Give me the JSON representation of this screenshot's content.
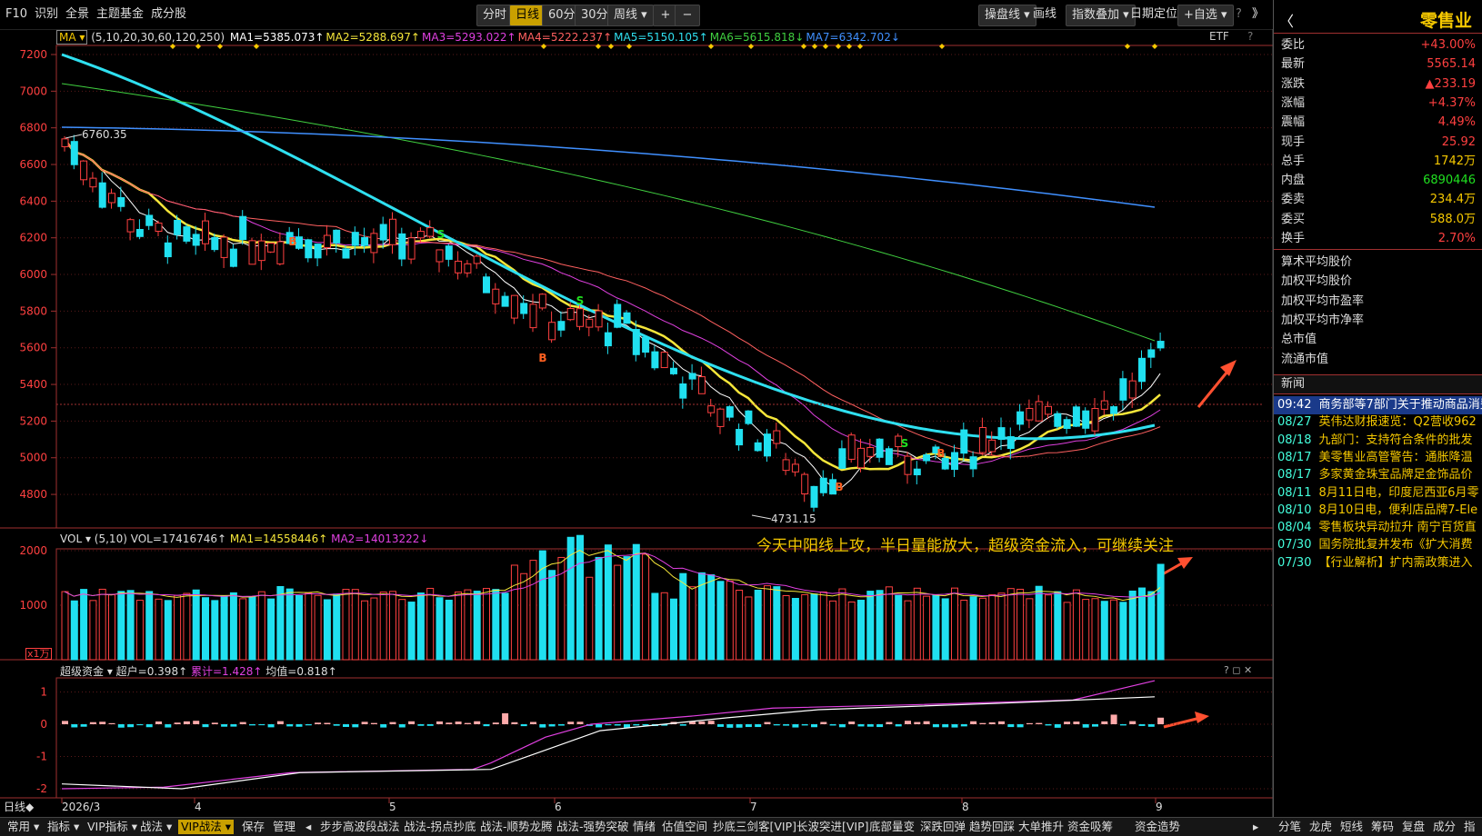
{
  "topbar": {
    "items": [
      "F10",
      "识别",
      "全景",
      "主题基金",
      "成分股"
    ],
    "periods": [
      "分时",
      "日线",
      "60分",
      "30分",
      "周线 ▾"
    ],
    "active_period": "日线",
    "zoom_in": "+",
    "zoom_out": "−",
    "right_items": [
      "操盘线 ▾",
      "画线",
      "指数叠加 ▾",
      "日期定位",
      "+自选 ▾"
    ],
    "help": "?",
    "collapse": "》"
  },
  "ma_legend": {
    "selector": "MA ▾",
    "params": "(5,10,20,30,60,120,250)",
    "lines": [
      {
        "text": "MA1=5385.073↑",
        "color": "#ffffff"
      },
      {
        "text": "MA2=5288.697↑",
        "color": "#f5e63a"
      },
      {
        "text": "MA3=5293.022↑",
        "color": "#e040e0"
      },
      {
        "text": "MA4=5222.237↑",
        "color": "#ff6060"
      },
      {
        "text": "MA5=5150.105↑",
        "color": "#2fe0f0"
      },
      {
        "text": "MA6=5615.818↓",
        "color": "#40d040"
      },
      {
        "text": "MA7=6342.702↓",
        "color": "#4090ff"
      }
    ],
    "etf": "ETF",
    "help": "?"
  },
  "price_axis": [
    "7200",
    "7000",
    "6800",
    "6600",
    "6400",
    "6200",
    "6000",
    "5800",
    "5600",
    "5400",
    "5200",
    "5000",
    "4800"
  ],
  "price_labels": {
    "high": "6760.35",
    "low": "4731.15"
  },
  "vol_legend": {
    "selector": "VOL ▾",
    "params": "(5,10)",
    "vol": "VOL=17416746↑",
    "ma1": "MA1=14558446↑",
    "ma2": "MA2=14013222↓"
  },
  "vol_axis": [
    "2000",
    "1000"
  ],
  "vol_unit": "x1万",
  "annotation": "今天中阳线上攻，半日量能放大，超级资金流入，可继续关注",
  "fund_legend": {
    "selector": "超级资金 ▾",
    "a": "超户=0.398↑",
    "b": "累计=1.428↑",
    "c": "均值=0.818↑",
    "controls": "? ◻ ✕"
  },
  "fund_axis": [
    "1",
    "0",
    "-1",
    "-2"
  ],
  "date_axis": {
    "period": "日线◆",
    "labels": [
      "2026/3",
      "4",
      "5",
      "6",
      "7",
      "8",
      "9"
    ]
  },
  "bottombar": {
    "items": [
      "常用 ▾",
      "指标 ▾",
      "VIP指标 ▾",
      "战法 ▾",
      "VIP战法 ▾",
      "保存",
      "管理",
      "◂",
      "步步高波段战法",
      "战法-拐点抄底",
      "战法-顺势龙腾",
      "战法-强势突破",
      "情绪",
      "估值空间",
      "抄底三剑客[VIP]",
      "长波突进[VIP]",
      "底部量变",
      "深跌回弹",
      "趋势回踩",
      "大单推升",
      "资金吸筹",
      "资金造势",
      "▸"
    ]
  },
  "quote": {
    "back": "〈",
    "name": "零售业",
    "rows": [
      {
        "k": "委比",
        "v": "+43.00%",
        "c": "#ff4040"
      },
      {
        "k": "最新",
        "v": "5565.14",
        "c": "#ff4040"
      },
      {
        "k": "涨跌",
        "v": "▲233.19",
        "c": "#ff4040"
      },
      {
        "k": "涨幅",
        "v": "+4.37%",
        "c": "#ff4040"
      },
      {
        "k": "震幅",
        "v": "4.49%",
        "c": "#ff4040"
      },
      {
        "k": "现手",
        "v": "25.92",
        "c": "#ff4040"
      },
      {
        "k": "总手",
        "v": "1742万",
        "c": "#f5c800"
      },
      {
        "k": "内盘",
        "v": "6890446",
        "c": "#20e020"
      },
      {
        "k": "委卖",
        "v": "234.4万",
        "c": "#f5c800"
      },
      {
        "k": "委买",
        "v": "588.0万",
        "c": "#f5c800"
      },
      {
        "k": "换手",
        "v": "2.70%",
        "c": "#ff4040"
      }
    ],
    "stats": [
      "算术平均股价",
      "加权平均股价",
      "加权平均市盈率",
      "加权平均市净率",
      "总市值",
      "流通市值"
    ]
  },
  "news": {
    "title": "新闻",
    "items": [
      {
        "d": "09:42",
        "t": "商务部等7部门关于推动商品消费",
        "hl": true
      },
      {
        "d": "08/27",
        "t": "英伟达财报速览：Q2营收962"
      },
      {
        "d": "08/18",
        "t": "九部门：支持符合条件的批发"
      },
      {
        "d": "08/17",
        "t": "美零售业高管警告：通胀降温"
      },
      {
        "d": "08/17",
        "t": "多家黄金珠宝品牌足金饰品价"
      },
      {
        "d": "08/11",
        "t": "8月11日电，印度尼西亚6月零"
      },
      {
        "d": "08/10",
        "t": "8月10日电，便利店品牌7-Ele"
      },
      {
        "d": "08/04",
        "t": "零售板块异动拉升 南宁百货直"
      },
      {
        "d": "07/30",
        "t": "国务院批复并发布《扩大消费"
      },
      {
        "d": "07/30",
        "t": "【行业解析】扩内需政策进入"
      }
    ]
  },
  "rp_bottom": [
    "分笔",
    "龙虎",
    "短线",
    "筹码",
    "复盘",
    "成分",
    "指"
  ]
}
